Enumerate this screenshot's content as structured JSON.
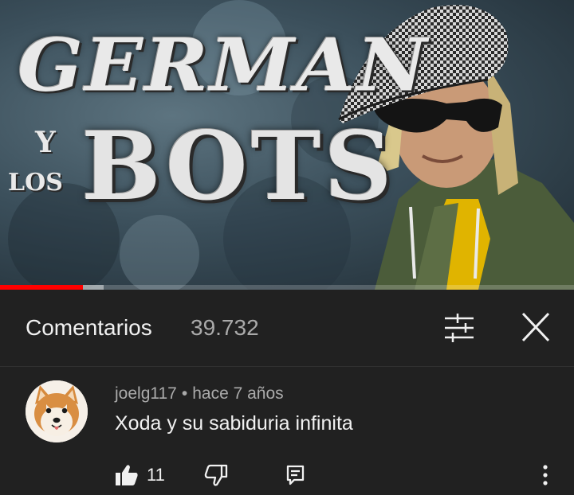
{
  "video": {
    "thumbnail_title_lines": [
      "GERMAN",
      "Y",
      "LOS",
      "BOTS"
    ],
    "progress_fraction": 0.145,
    "buffer_fraction": 0.18,
    "colors": {
      "played": "#ff0000"
    }
  },
  "comments_panel": {
    "title": "Comentarios",
    "count": "39.732",
    "icons": {
      "sort": "sort-filter-icon",
      "close": "close-icon"
    }
  },
  "comment": {
    "author": "joelg117",
    "separator": "•",
    "time": "hace 7 años",
    "text": "Xoda y su sabiduria infinita",
    "likes": "11",
    "icons": {
      "avatar": "shiba-dog-avatar",
      "like": "thumbs-up-icon",
      "dislike": "thumbs-down-icon",
      "reply": "reply-icon",
      "more": "more-vertical-icon"
    }
  }
}
